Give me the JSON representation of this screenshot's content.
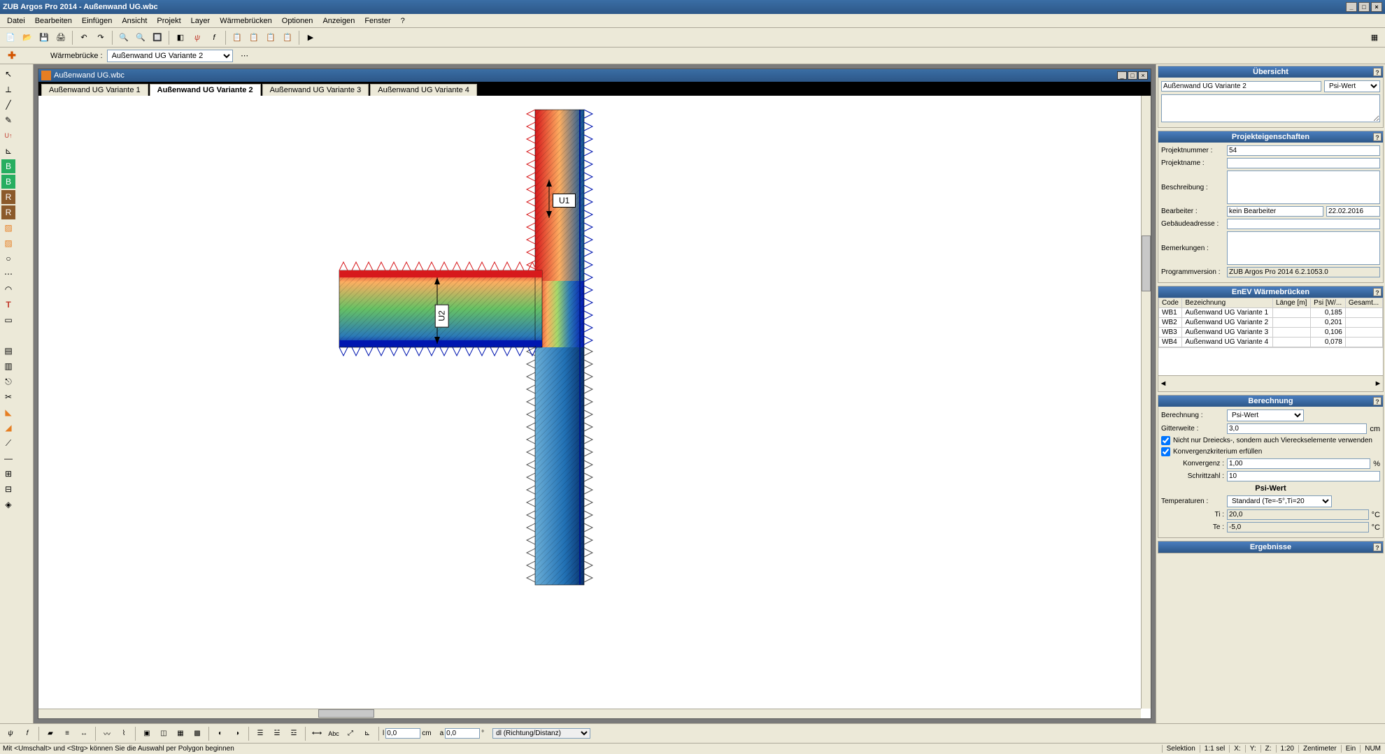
{
  "app": {
    "title": "ZUB Argos Pro 2014 - Außenwand UG.wbc",
    "version": "ZUB Argos Pro 2014 6.2.1053.0"
  },
  "menu": [
    "Datei",
    "Bearbeiten",
    "Einfügen",
    "Ansicht",
    "Projekt",
    "Layer",
    "Wärmebrücken",
    "Optionen",
    "Anzeigen",
    "Fenster",
    "?"
  ],
  "selectbar": {
    "label": "Wärmebrücke :",
    "value": "Außenwand UG Variante 2"
  },
  "doc": {
    "title": "Außenwand UG.wbc",
    "tabs": [
      "Außenwand UG Variante 1",
      "Außenwand UG Variante 2",
      "Außenwand UG Variante 3",
      "Außenwand UG Variante 4"
    ],
    "active_tab": 1,
    "labels": {
      "u1": "U1",
      "u2": "U2"
    }
  },
  "panels": {
    "uebersicht": {
      "title": "Übersicht",
      "item": "Außenwand UG Variante 2",
      "metric": "Psi-Wert"
    },
    "projekt": {
      "title": "Projekteigenschaften",
      "nummer_label": "Projektnummer :",
      "nummer": "54",
      "name_label": "Projektname :",
      "name": "",
      "beschreibung_label": "Beschreibung :",
      "beschreibung": "",
      "bearbeiter_label": "Bearbeiter :",
      "bearbeiter": "kein Bearbeiter",
      "datum": "22.02.2016",
      "adresse_label": "Gebäudeadresse :",
      "adresse": "",
      "bemerkungen_label": "Bemerkungen :",
      "bemerkungen": "",
      "programm_label": "Programmversion :"
    },
    "enev": {
      "title": "EnEV Wärmebrücken",
      "cols": [
        "Code",
        "Bezeichnung",
        "Länge [m]",
        "Psi [W/...",
        "Gesamt..."
      ],
      "rows": [
        {
          "code": "WB1",
          "bez": "Außenwand UG Variante 1",
          "len": "",
          "psi": "0,185",
          "ges": ""
        },
        {
          "code": "WB2",
          "bez": "Außenwand UG Variante 2",
          "len": "",
          "psi": "0,201",
          "ges": ""
        },
        {
          "code": "WB3",
          "bez": "Außenwand UG Variante 3",
          "len": "",
          "psi": "0,106",
          "ges": ""
        },
        {
          "code": "WB4",
          "bez": "Außenwand UG Variante 4",
          "len": "",
          "psi": "0,078",
          "ges": ""
        }
      ]
    },
    "berechnung": {
      "title": "Berechnung",
      "berechnung_label": "Berechnung :",
      "berechnung": "Psi-Wert",
      "gitter_label": "Gitterweite :",
      "gitter": "3,0",
      "gitter_unit": "cm",
      "ck1": "Nicht nur Dreiecks-, sondern auch Viereckselemente verwenden",
      "ck2": "Konvergenzkriterium erfüllen",
      "konv_label": "Konvergenz :",
      "konv": "1,00",
      "konv_unit": "%",
      "schritt_label": "Schrittzahl :",
      "schritt": "10",
      "psi_header": "Psi-Wert",
      "temp_label": "Temperaturen :",
      "temp": "Standard (Te=-5°,Ti=20",
      "ti_label": "Ti :",
      "ti": "20,0",
      "te_label": "Te :",
      "te": "-5,0",
      "deg": "°C"
    },
    "ergebnisse": {
      "title": "Ergebnisse"
    }
  },
  "bottombar": {
    "l_label": "l",
    "l": "0,0",
    "unit_cm": "cm",
    "a_label": "a",
    "a": "0,0",
    "deg": "°",
    "mode": "dl (Richtung/Distanz)"
  },
  "status": {
    "hint": "Mit <Umschalt> und <Strg> können Sie die Auswahl per Polygon beginnen",
    "selektion": "Selektion",
    "sel_ratio": "1:1 sel",
    "x": "X:",
    "y": "Y:",
    "z": "Z:",
    "zoom": "1:20",
    "unit": "Zentimeter",
    "ein": "Ein",
    "num": "NUM"
  }
}
